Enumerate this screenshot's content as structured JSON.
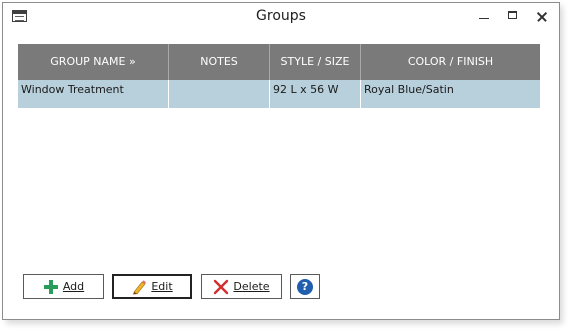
{
  "window": {
    "title": "Groups"
  },
  "grid": {
    "columns": [
      "GROUP NAME »",
      "NOTES",
      "STYLE / SIZE",
      "COLOR / FINISH"
    ],
    "rows": [
      {
        "group_name": "Window Treatment",
        "notes": "",
        "style_size": "92 L x 56 W",
        "color_finish": "Royal Blue/Satin"
      }
    ]
  },
  "buttons": {
    "add": "Add",
    "edit": "Edit",
    "delete": "Delete",
    "help": "?"
  },
  "colors": {
    "header_bg": "#7a7a7a",
    "selected_row_bg": "#b8d0dc",
    "add_icon": "#2a9d5c",
    "delete_icon": "#d32f2f",
    "help_icon": "#1f5fae"
  },
  "icons": {
    "add": "plus-icon",
    "edit": "pencil-icon",
    "delete": "x-icon",
    "help": "help-icon"
  }
}
